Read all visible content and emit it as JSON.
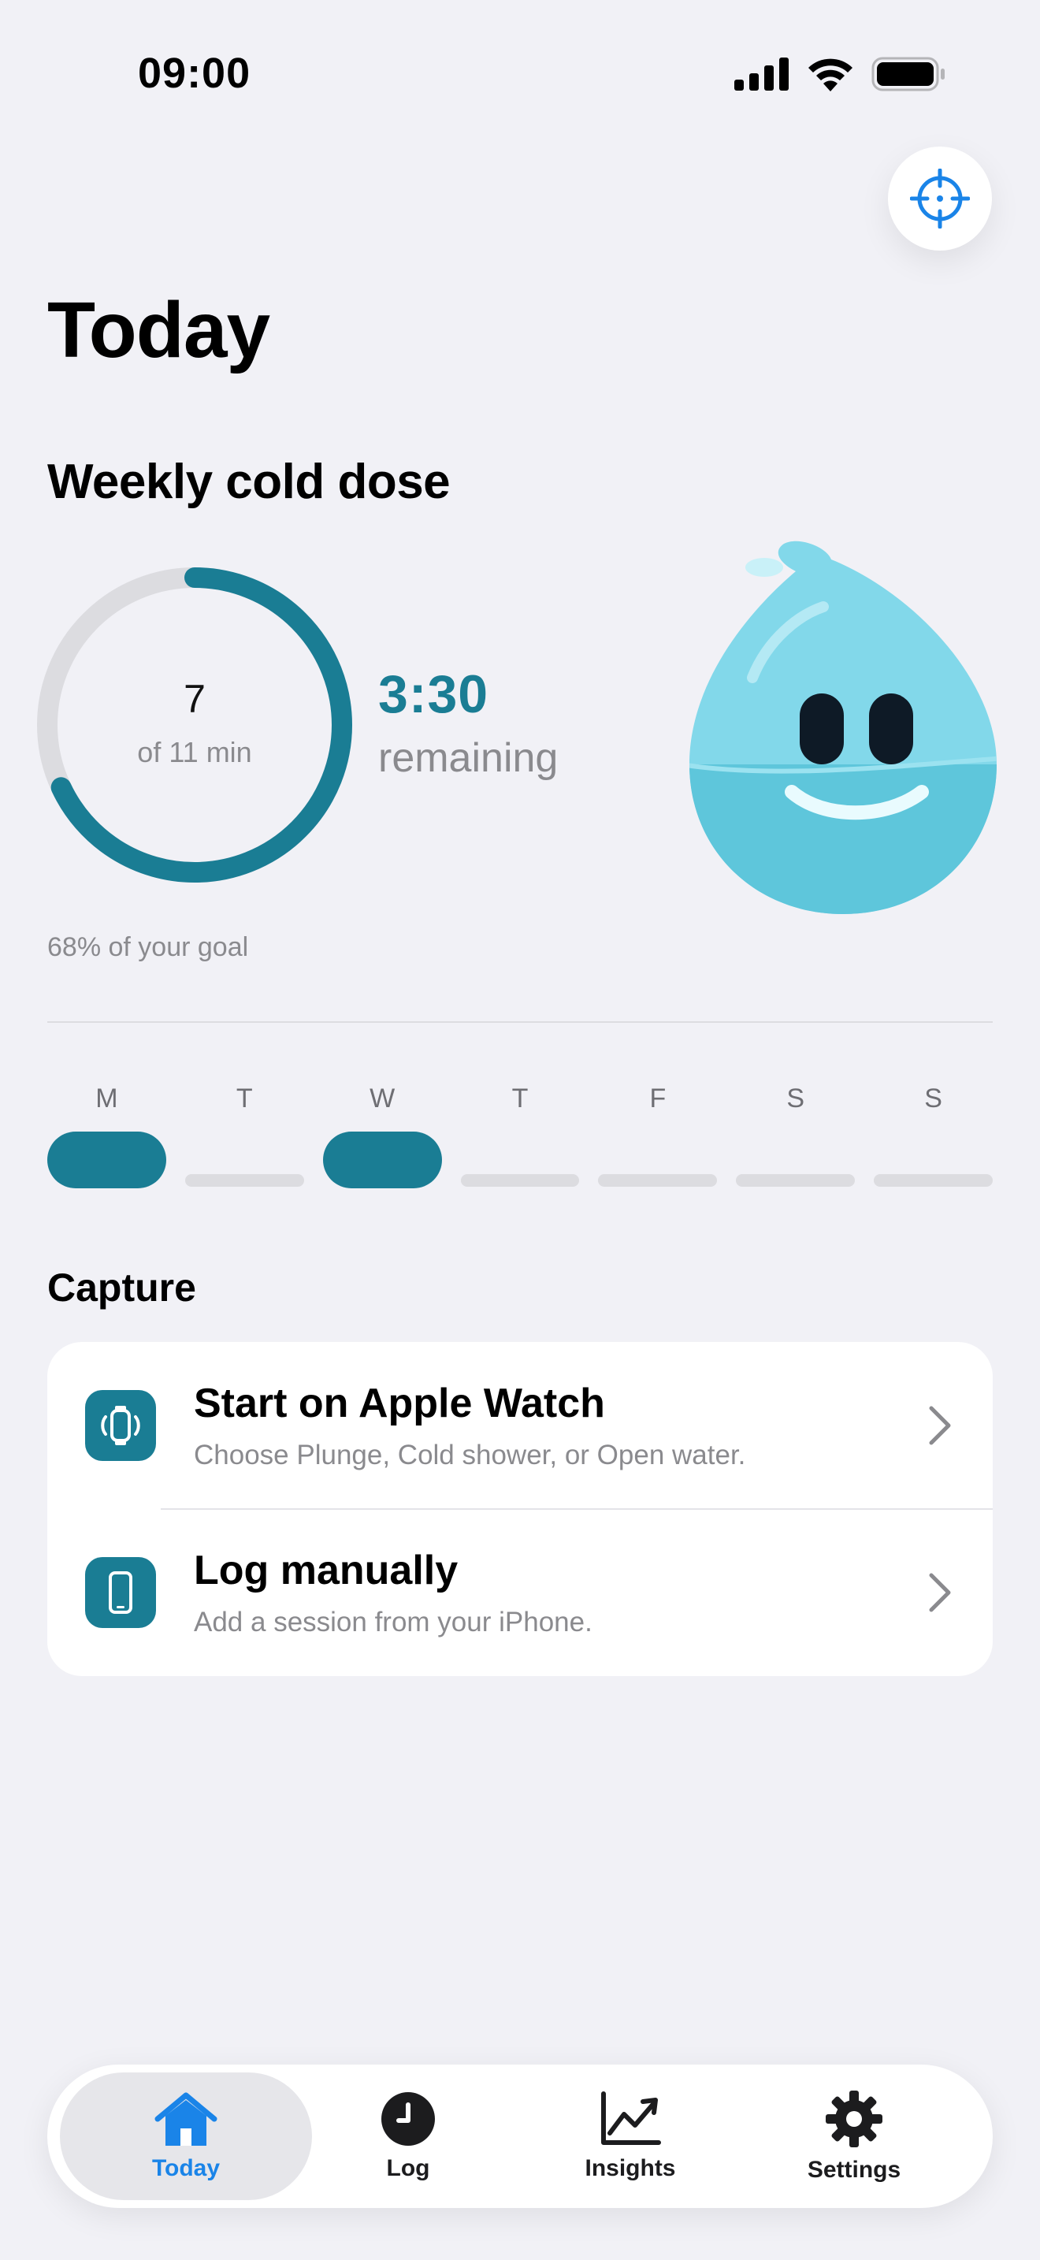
{
  "status_bar": {
    "time": "09:00"
  },
  "page": {
    "title": "Today"
  },
  "weekly": {
    "section_title": "Weekly cold dose",
    "ring_value": "7",
    "ring_sub": "of 11 min",
    "progress_fraction": 0.68,
    "remaining_time": "3:30",
    "remaining_label": "remaining",
    "goal_text": "68% of your goal"
  },
  "week": [
    {
      "letter": "M",
      "done": true
    },
    {
      "letter": "T",
      "done": false
    },
    {
      "letter": "W",
      "done": true
    },
    {
      "letter": "T",
      "done": false
    },
    {
      "letter": "F",
      "done": false
    },
    {
      "letter": "S",
      "done": false
    },
    {
      "letter": "S",
      "done": false
    }
  ],
  "capture": {
    "title": "Capture",
    "items": [
      {
        "title": "Start on Apple Watch",
        "subtitle": "Choose Plunge, Cold shower, or Open water.",
        "icon": "watch-icon"
      },
      {
        "title": "Log manually",
        "subtitle": "Add a session from your iPhone.",
        "icon": "iphone-icon"
      }
    ]
  },
  "tabs": [
    {
      "label": "Today",
      "icon": "house-icon",
      "active": true
    },
    {
      "label": "Log",
      "icon": "clock-icon",
      "active": false
    },
    {
      "label": "Insights",
      "icon": "chart-icon",
      "active": false
    },
    {
      "label": "Settings",
      "icon": "gear-icon",
      "active": false
    }
  ],
  "colors": {
    "accent": "#1A7D94",
    "tab_active": "#1A84E8",
    "background": "#F1F1F6",
    "track": "#DCDCE0",
    "mascot": "#7DD6E8"
  }
}
